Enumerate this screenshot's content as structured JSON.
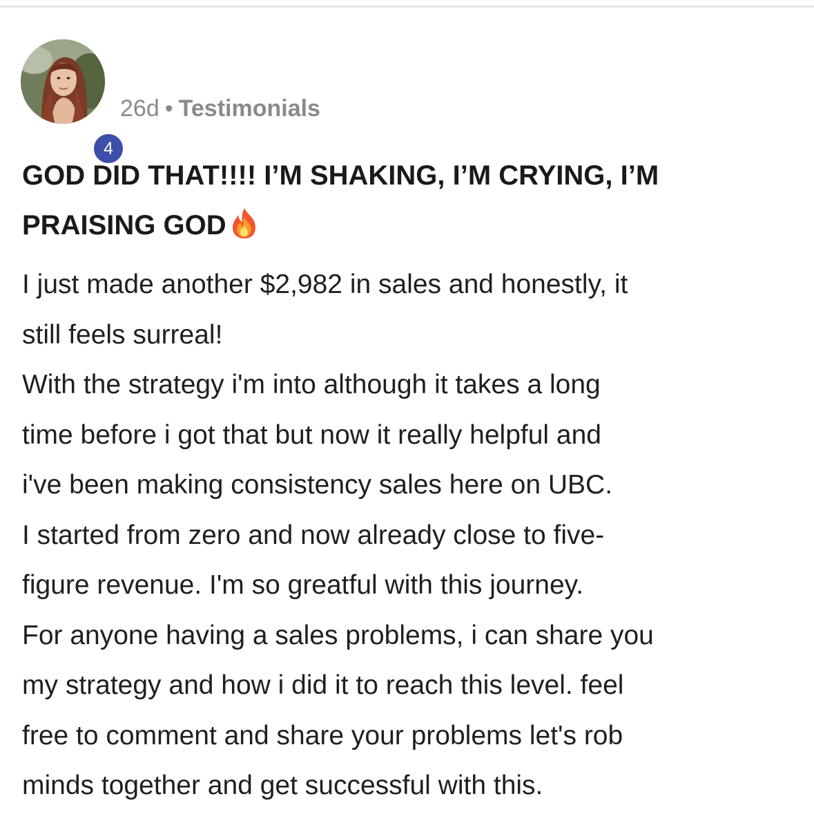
{
  "post": {
    "author_level": "4",
    "age": "26d",
    "separator": "•",
    "category": "Testimonials",
    "title": "GOD DID THAT!!!! I’M SHAKING, I’M CRYING, I’M PRAISING GOD",
    "title_line1": "GOD DID THAT!!!! I’M SHAKING, I’M CRYING, I’M",
    "title_line2": "PRAISING GOD",
    "title_emoji": "fire-icon",
    "body_lines": [
      "I just made another $2,982 in sales and honestly, it",
      "still feels surreal!",
      "With the strategy i'm into although it takes a long",
      "time before i got that but now it really helpful and",
      "i've been making consistency sales here on UBC.",
      "I started from zero and now already close to five-",
      "figure revenue. I'm so greatful with this journey.",
      "For anyone having a sales problems, i can share you",
      "my strategy and how i did it to reach this level. feel",
      "free to comment and share your problems let's rob",
      "minds together and get successful with this."
    ]
  },
  "colors": {
    "badge": "#3d4fa8",
    "meta_text": "#8a8a8a",
    "title_text": "#1a1a1a",
    "body_text": "#1f1f1f",
    "divider": "#e6e6e6"
  }
}
